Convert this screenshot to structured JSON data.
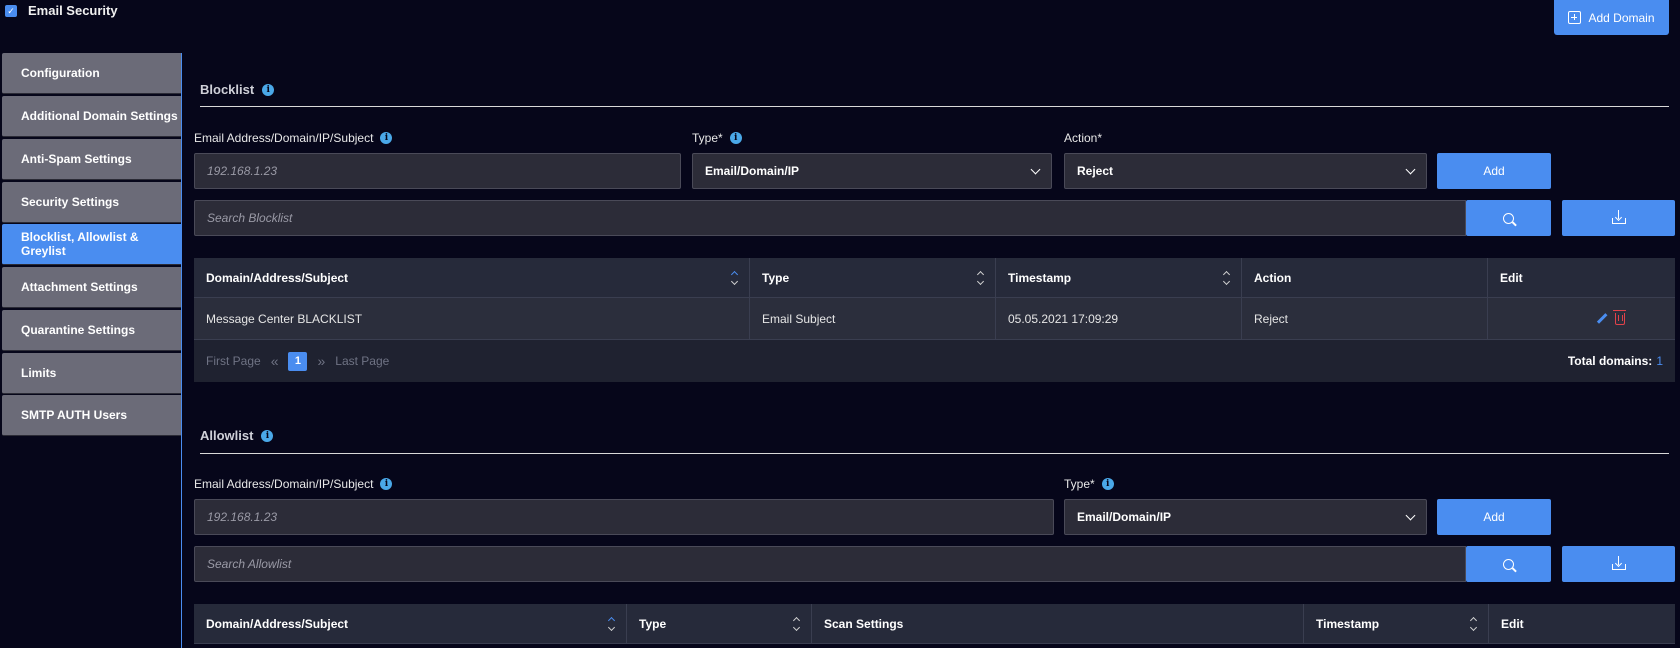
{
  "app": {
    "title": "Email Security",
    "add_domain_label": "Add Domain"
  },
  "sidebar": {
    "items": [
      {
        "label": "Configuration"
      },
      {
        "label": "Additional Domain Settings"
      },
      {
        "label": "Anti-Spam Settings"
      },
      {
        "label": "Security Settings"
      },
      {
        "label": "Blocklist, Allowlist & Greylist",
        "active": true
      },
      {
        "label": "Attachment Settings"
      },
      {
        "label": "Quarantine Settings"
      },
      {
        "label": "Limits"
      },
      {
        "label": "SMTP AUTH Users"
      }
    ]
  },
  "blocklist": {
    "title": "Blocklist",
    "address_label": "Email Address/Domain/IP/Subject",
    "address_placeholder": "192.168.1.23",
    "type_label": "Type*",
    "type_value": "Email/Domain/IP",
    "action_label": "Action*",
    "action_value": "Reject",
    "add_label": "Add",
    "search_placeholder": "Search Blocklist",
    "columns": [
      "Domain/Address/Subject",
      "Type",
      "Timestamp",
      "Action",
      "Edit"
    ],
    "rows": [
      {
        "domain": "Message Center BLACKLIST",
        "type": "Email Subject",
        "timestamp": "05.05.2021  17:09:29",
        "action": "Reject"
      }
    ],
    "pager": {
      "first": "First Page",
      "page": "1",
      "last": "Last Page",
      "total_label": "Total domains:",
      "total_value": "1"
    }
  },
  "allowlist": {
    "title": "Allowlist",
    "address_label": "Email Address/Domain/IP/Subject",
    "address_placeholder": "192.168.1.23",
    "type_label": "Type*",
    "type_value": "Email/Domain/IP",
    "add_label": "Add",
    "search_placeholder": "Search Allowlist",
    "columns": [
      "Domain/Address/Subject",
      "Type",
      "Scan Settings",
      "Timestamp",
      "Edit"
    ]
  },
  "colors": {
    "accent": "#4a8df0",
    "background": "#06061a",
    "sidebar_item": "#6b6b78",
    "delete": "#e0424a"
  }
}
